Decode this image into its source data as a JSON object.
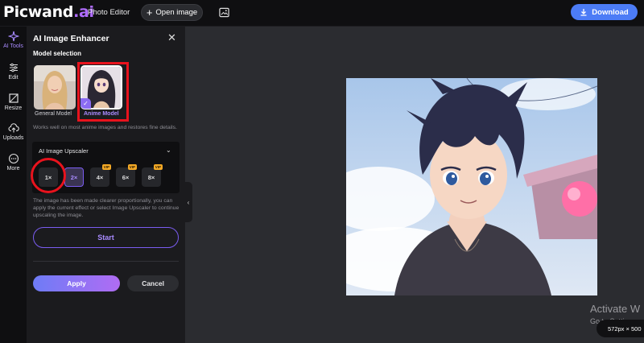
{
  "header": {
    "logo_main": "Picwand",
    "logo_suffix": ".ai",
    "photo_editor": "Photo Editor",
    "open_image": "Open image",
    "download": "Download",
    "accent_color": "#4c7cf6",
    "brand_color": "#b06cff"
  },
  "rail": {
    "items": [
      {
        "label": "AI Tools",
        "icon": "sparkle-icon"
      },
      {
        "label": "Edit",
        "icon": "sliders-icon"
      },
      {
        "label": "Resize",
        "icon": "crop-icon"
      },
      {
        "label": "Uploads",
        "icon": "cloud-upload-icon"
      },
      {
        "label": "More",
        "icon": "more-icon"
      }
    ]
  },
  "panel": {
    "title": "AI Image Enhancer",
    "close": "✕",
    "model_selection": "Model selection",
    "models": [
      {
        "label": "General Model",
        "selected": false
      },
      {
        "label": "Anime Model",
        "selected": true
      }
    ],
    "model_description": "Works well on most anime images and restores fine details.",
    "upscaler": {
      "title": "AI Image Upscaler",
      "options": [
        {
          "label": "1×",
          "vip": false,
          "selected": false
        },
        {
          "label": "2×",
          "vip": false,
          "selected": true
        },
        {
          "label": "4×",
          "vip": true,
          "selected": false
        },
        {
          "label": "6×",
          "vip": true,
          "selected": false
        },
        {
          "label": "8×",
          "vip": true,
          "selected": false
        }
      ],
      "vip_badge": "VIP"
    },
    "upscaler_note": "The image has been made clearer proportionally, you can apply the current effect or select Image Upscaler to continue upscaling the image.",
    "start": "Start",
    "apply": "Apply",
    "cancel": "Cancel"
  },
  "canvas": {
    "watermark_line1": "Activate W",
    "watermark_line2": "Go to Setting",
    "image_size": "572px × 500"
  }
}
